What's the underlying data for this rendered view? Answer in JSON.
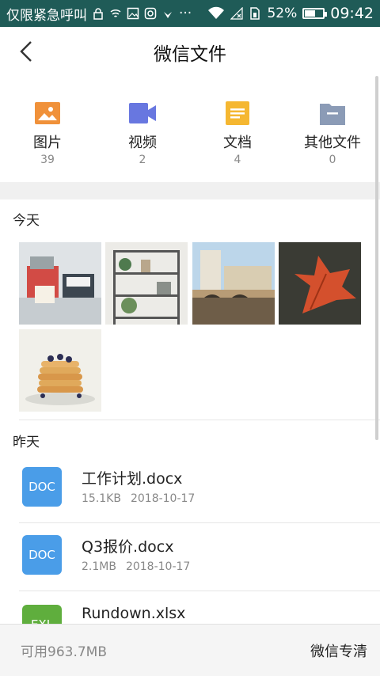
{
  "status_bar": {
    "carrier_text": "仅限紧急呼叫",
    "more": "···",
    "battery_percent": "52%",
    "battery_level": 0.52,
    "time": "09:42"
  },
  "header": {
    "title": "微信文件"
  },
  "categories": [
    {
      "label": "图片",
      "count": "39",
      "icon": "image-icon",
      "color": "#f0913a"
    },
    {
      "label": "视频",
      "count": "2",
      "icon": "video-icon",
      "color": "#6877e0"
    },
    {
      "label": "文档",
      "count": "4",
      "icon": "document-icon",
      "color": "#f5b731"
    },
    {
      "label": "其他文件",
      "count": "0",
      "icon": "folder-icon",
      "color": "#8b9bb6"
    }
  ],
  "today": {
    "label": "今天"
  },
  "yesterday": {
    "label": "昨天"
  },
  "files": [
    {
      "badge": "DOC",
      "name": "工作计划.docx",
      "size": "15.1KB",
      "date": "2018-10-17",
      "color": "#4a9de8"
    },
    {
      "badge": "DOC",
      "name": "Q3报价.docx",
      "size": "2.1MB",
      "date": "2018-10-17",
      "color": "#4a9de8"
    },
    {
      "badge": "EXL",
      "name": "Rundown.xlsx",
      "size": "",
      "date": "",
      "color": "#5fae3d"
    }
  ],
  "bottom": {
    "available": "可用963.7MB",
    "clean": "微信专清"
  }
}
